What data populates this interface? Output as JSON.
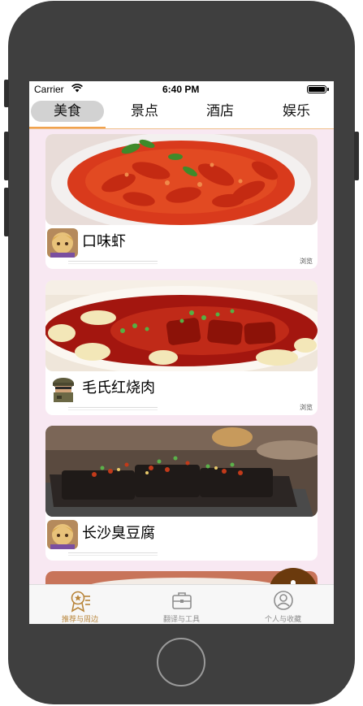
{
  "status_bar": {
    "carrier": "Carrier",
    "time": "6:40 PM"
  },
  "top_tabs": [
    {
      "label": "美食",
      "active": true
    },
    {
      "label": "景点",
      "active": false
    },
    {
      "label": "酒店",
      "active": false
    },
    {
      "label": "娱乐",
      "active": false
    }
  ],
  "cards": [
    {
      "title": "口味虾",
      "browse_label": "浏览",
      "image": "crayfish-dish-photo",
      "avatar": "cartoon-avatar"
    },
    {
      "title": "毛氏红烧肉",
      "browse_label": "浏览",
      "image": "braised-pork-dish-photo",
      "avatar": "soldier-avatar"
    },
    {
      "title": "长沙臭豆腐",
      "browse_label": "",
      "image": "stinky-tofu-dish-photo",
      "avatar": "cartoon-avatar"
    }
  ],
  "fab": {
    "icon": "plus-icon"
  },
  "bottom_tabs": [
    {
      "label": "推荐与周边",
      "icon": "badge-icon",
      "active": true
    },
    {
      "label": "翻译与工具",
      "icon": "briefcase-icon",
      "active": false
    },
    {
      "label": "个人与收藏",
      "icon": "user-circle-icon",
      "active": false
    }
  ],
  "colors": {
    "accent": "#f1a24d",
    "active_tab_text": "#b8853a",
    "fab": "#6b3a0d",
    "feed_background": "#f8e8f2"
  }
}
